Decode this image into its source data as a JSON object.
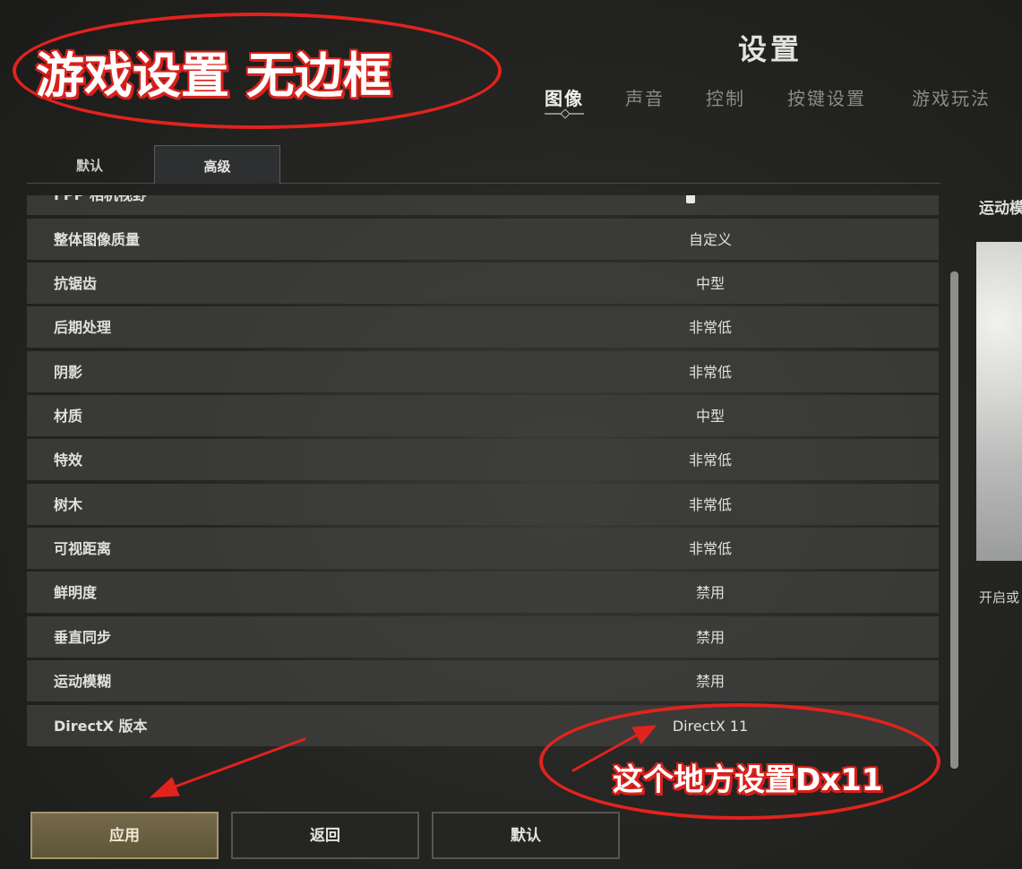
{
  "header": {
    "title": "设置"
  },
  "main_tabs": [
    {
      "label": "图像",
      "active": true
    },
    {
      "label": "声音",
      "active": false
    },
    {
      "label": "控制",
      "active": false
    },
    {
      "label": "按键设置",
      "active": false
    },
    {
      "label": "游戏玩法",
      "active": false
    }
  ],
  "sub_tabs": [
    {
      "label": "默认",
      "active": false
    },
    {
      "label": "高级",
      "active": true
    }
  ],
  "settings": {
    "partial_row": {
      "label": "FPP 相机视野",
      "value": "90",
      "slider_fraction": 0.43
    },
    "rows": [
      {
        "label": "整体图像质量",
        "value": "自定义"
      },
      {
        "label": "抗锯齿",
        "value": "中型"
      },
      {
        "label": "后期处理",
        "value": "非常低"
      },
      {
        "label": "阴影",
        "value": "非常低"
      },
      {
        "label": "材质",
        "value": "中型"
      },
      {
        "label": "特效",
        "value": "非常低"
      },
      {
        "label": "树木",
        "value": "非常低"
      },
      {
        "label": "可视距离",
        "value": "非常低"
      },
      {
        "label": "鲜明度",
        "value": "禁用"
      },
      {
        "label": "垂直同步",
        "value": "禁用"
      },
      {
        "label": "运动模糊",
        "value": "禁用"
      },
      {
        "label": "DirectX 版本",
        "value": "DirectX 11"
      }
    ]
  },
  "side_panel": {
    "title": "运动模",
    "description": "开启或"
  },
  "buttons": {
    "apply": "应用",
    "back": "返回",
    "default": "默认"
  },
  "annotations": {
    "top_note": "游戏设置 无边框",
    "bottom_note": "这个地方设置Dx11",
    "color": "#e2231d"
  }
}
